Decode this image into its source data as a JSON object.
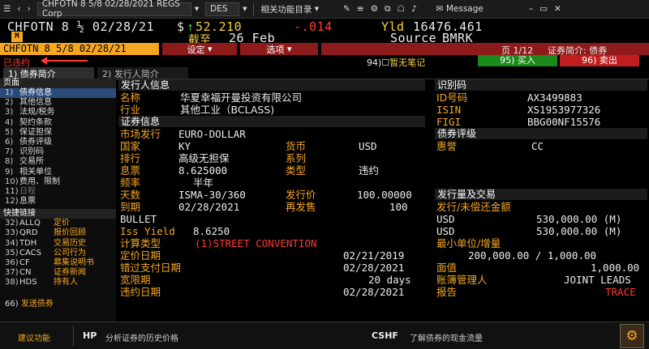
{
  "topbar": {
    "security": "CHFOTN 8 5/8 02/28/2021 REGS Corp",
    "function": "DES",
    "related": "相关功能目录",
    "message": "Message"
  },
  "header": {
    "ticker": "CHFOTN 8 ½ 02/28/21",
    "price_flag": "$",
    "price": "52.210",
    "change": "-.014",
    "yld_label": "Yld",
    "yld_value": "16476.461",
    "cutoff_label": "截至",
    "cutoff_date": "26 Feb",
    "source_label": "Source",
    "source_value": "BMRK",
    "icon_label": "M"
  },
  "menubar": {
    "ticker_box": "CHFOTN 8 5/8 02/28/21",
    "settings": "设定",
    "options": "选项",
    "page": "页 1/12",
    "page_title": "证券简介: 债券",
    "status": "已违约",
    "note_num": "94)",
    "note": "暂无笔记",
    "buy_num": "95)",
    "buy": "买入",
    "sell_num": "96)",
    "sell": "卖出"
  },
  "tabs": [
    {
      "num": "1)",
      "label": "债券简介"
    },
    {
      "num": "2)",
      "label": "发行人简介"
    }
  ],
  "sidebar": {
    "head": "页面",
    "items": [
      {
        "num": "1)",
        "label": "债券信息"
      },
      {
        "num": "2)",
        "label": "其他信息"
      },
      {
        "num": "3)",
        "label": "法规/税务"
      },
      {
        "num": "4)",
        "label": "契约条款"
      },
      {
        "num": "5)",
        "label": "保证担保"
      },
      {
        "num": "6)",
        "label": "债券评级"
      },
      {
        "num": "7)",
        "label": "识别码"
      },
      {
        "num": "8)",
        "label": "交易所"
      },
      {
        "num": "9)",
        "label": "相关单位"
      },
      {
        "num": "10)",
        "label": "费用、限制"
      },
      {
        "num": "11)",
        "label": "日程"
      },
      {
        "num": "12)",
        "label": "息票"
      }
    ],
    "quick_head": "快捷链接",
    "quick": [
      {
        "num": "32)",
        "code": "ALLQ",
        "label": "定价"
      },
      {
        "num": "33)",
        "code": "QRD",
        "label": "报价回顾"
      },
      {
        "num": "34)",
        "code": "TDH",
        "label": "交易历史"
      },
      {
        "num": "35)",
        "code": "CACS",
        "label": "公司行为"
      },
      {
        "num": "36)",
        "code": "CF",
        "label": "募集说明书"
      },
      {
        "num": "37)",
        "code": "CN",
        "label": "证券新闻"
      },
      {
        "num": "38)",
        "code": "HDS",
        "label": "持有人"
      }
    ],
    "send_num": "66)",
    "send": "发送债券"
  },
  "issuer": {
    "title": "发行人信息",
    "name_label": "名称",
    "name": "华夏幸福开曼投资有限公司",
    "industry_label": "行业",
    "industry": "其他工业（BCLASS)"
  },
  "security": {
    "title": "证券信息",
    "market_label": "市场发行",
    "market": "EURO-DOLLAR",
    "country_label": "国家",
    "country": "KY",
    "currency_label": "货币",
    "currency": "USD",
    "rank_label": "排行",
    "rank": "高级无担保",
    "series_label": "系列",
    "series": "",
    "coupon_label": "息票",
    "coupon": "8.625000",
    "type_label": "类型",
    "type": "违约",
    "freq_label": "频率",
    "freq": "半年",
    "days_label": "天数",
    "days": "ISMA-30/360",
    "issue_price_label": "发行价",
    "issue_price": "100.00000",
    "maturity_label": "到期",
    "maturity": "02/28/2021",
    "reissue_label": "再发售",
    "reissue": "100",
    "bullet": "BULLET",
    "iss_yield_label": "Iss Yield",
    "iss_yield": "8.6250",
    "calc_label": "计算类型",
    "calc": "(1)STREET CONVENTION",
    "pricing_date_label": "定价日期",
    "pricing_date": "02/21/2019",
    "missed_label": "错过支付日期",
    "missed": "02/28/2021",
    "grace_label": "宽限期",
    "grace": "20 days",
    "default_date_label": "违约日期",
    "default_date": "02/28/2021"
  },
  "identifiers": {
    "title": "识别码",
    "id_label": "ID号码",
    "id": "AX3499883",
    "isin_label": "ISIN",
    "isin": "XS1953977326",
    "figi_label": "FIGI",
    "figi": "BBG00NF15576"
  },
  "rating": {
    "title": "债券评级",
    "agency_label": "惠誉",
    "agency": "CC"
  },
  "issuance": {
    "title": "发行量及交易",
    "amt_label": "发行/未偿还金额",
    "cur1": "USD",
    "amt1": "530,000.00 (M)",
    "cur2": "USD",
    "amt2": "530,000.00 (M)",
    "min_label": "最小单位/增量",
    "min": "200,000.00 / 1,000.00",
    "par_label": "面值",
    "par": "1,000.00",
    "book_label": "账簿管理人",
    "book": "JOINT LEADS",
    "report_label": "报告",
    "report": "TRACE"
  },
  "footer": {
    "suggest": "建议功能",
    "hp_code": "HP",
    "hp_desc": "分析证券的历史价格",
    "cshf_code": "CSHF",
    "cshf_desc": "了解债券的现金流量"
  }
}
